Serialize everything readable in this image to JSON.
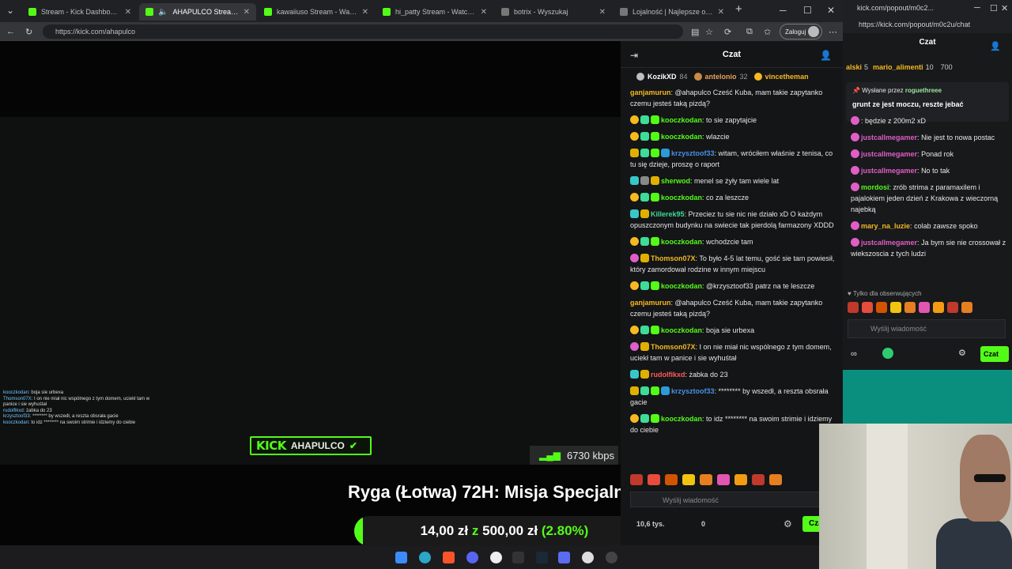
{
  "browser": {
    "tabs": [
      {
        "label": "Stream - Kick Dashboard",
        "active": false
      },
      {
        "label": "AHAPULCO Stream - Watch Live on Kick",
        "active": true
      },
      {
        "label": "kawaiiuso Stream - Watch Live on Kick",
        "active": false
      },
      {
        "label": "hi_patty Stream - Watch Live on Kick",
        "active": false
      },
      {
        "label": "botrix - Wyszukaj",
        "active": false
      },
      {
        "label": "Lojalność | Najlepsze oprogramowanie",
        "active": false
      }
    ],
    "url": "https://kick.com/ahapulco",
    "login_label": "Zaloguj"
  },
  "video": {
    "overlay_chat": [
      {
        "user": "kooczkodan",
        "text": "boja sie urbexa"
      },
      {
        "user": "Thomson07X",
        "text": "I on nie miał nic wspólnego z tym domem, uciekł tam w panice i sie wyhuśtał"
      },
      {
        "user": "rudolfikxd",
        "text": "żabka do 23"
      },
      {
        "user": "krzysztoof33",
        "text": "******** by wszedł, a reszta obsrała gacie"
      },
      {
        "user": "kooczkodan",
        "text": "to idz ******** na swoim strimie i idziemy do ciebie"
      }
    ],
    "kick_word": "KICK",
    "channel_name": "AHAPULCO",
    "bitrate": "6730 kbps",
    "stream_title": "Ryga (Łotwa) 72H: Misja Specjalna",
    "goal": {
      "current": "14,00 zł",
      "sep": "z",
      "target": "500,00 zł",
      "percent_text": "(2.80%)",
      "percent": 0.028
    }
  },
  "chat": {
    "title": "Czat",
    "top_gifters": [
      {
        "name": "KozikXD",
        "count": "84",
        "tier": "silver"
      },
      {
        "name": "antelonio",
        "count": "32",
        "tier": "bronze"
      },
      {
        "name": "vincetheman",
        "count": "",
        "tier": "gold"
      }
    ],
    "messages": [
      {
        "user": "ganjamurun",
        "color": "#f5b921",
        "badges": [],
        "text": "@ahapulco Cześć Kuba, mam takie zapytanko czemu jesteś taką pizdą?"
      },
      {
        "user": "kooczkodan",
        "color": "#53fc18",
        "badges": [
          "coin",
          "grid",
          "green"
        ],
        "text": "to sie zapytajcie"
      },
      {
        "user": "kooczkodan",
        "color": "#53fc18",
        "badges": [
          "coin",
          "grid",
          "green"
        ],
        "text": "wlazcie"
      },
      {
        "user": "krzysztoof33",
        "color": "#4a90e2",
        "badges": [
          "crown",
          "grid",
          "green",
          "blue"
        ],
        "text": "witam, wróciłem właśnie z tenisa, co tu się dzieje, proszę o raport"
      },
      {
        "user": "sherwod",
        "color": "#53fc18",
        "badges": [
          "teal",
          "gray",
          "crown"
        ],
        "text": "menel se żyły tam wiele lat"
      },
      {
        "user": "kooczkodan",
        "color": "#53fc18",
        "badges": [
          "coin",
          "grid",
          "green"
        ],
        "text": "co za leszcze"
      },
      {
        "user": "Killerek95",
        "color": "#3ddc97",
        "badges": [
          "teal",
          "crown"
        ],
        "text": "Przeciez tu sie nic nie działo xD O każdym opuszczonym budynku na swiecie tak pierdolą farmazony XDDD"
      },
      {
        "user": "kooczkodan",
        "color": "#53fc18",
        "badges": [
          "coin",
          "grid",
          "green"
        ],
        "text": "wchodzcie tam"
      },
      {
        "user": "Thomson07X",
        "color": "#f5b921",
        "badges": [
          "pink",
          "crown"
        ],
        "text": "To było 4-5 lat temu, gość sie tam powiesił, który zamordował rodzine w innym miejscu"
      },
      {
        "user": "kooczkodan",
        "color": "#53fc18",
        "badges": [
          "coin",
          "grid",
          "green"
        ],
        "text": "@krzysztoof33 patrz na te leszcze"
      },
      {
        "user": "ganjamurun",
        "color": "#f5b921",
        "badges": [],
        "text": "@ahapulco Cześć Kuba, mam takie zapytanko czemu jesteś taką pizdą?"
      },
      {
        "user": "kooczkodan",
        "color": "#53fc18",
        "badges": [
          "coin",
          "grid",
          "green"
        ],
        "text": "boja sie urbexa"
      },
      {
        "user": "Thomson07X",
        "color": "#f5b921",
        "badges": [
          "pink",
          "crown"
        ],
        "text": "I on nie miał nic wspólnego z tym domem, uciekł tam w panice i sie wyhuśtał"
      },
      {
        "user": "rudolfikxd",
        "color": "#ff5a5a",
        "badges": [
          "teal",
          "crown"
        ],
        "text": "żabka do 23"
      },
      {
        "user": "krzysztoof33",
        "color": "#4a90e2",
        "badges": [
          "crown",
          "grid",
          "green",
          "blue"
        ],
        "text": "******** by wszedł, a reszta obsrała gacie"
      },
      {
        "user": "kooczkodan",
        "color": "#53fc18",
        "badges": [
          "coin",
          "grid",
          "green"
        ],
        "text": "to idz ******** na swoim strimie i idziemy do ciebie"
      }
    ],
    "input_placeholder": "Wyślij wiadomość",
    "viewers": "10,6 tys.",
    "points": "0",
    "send_label": "Czat"
  },
  "popout": {
    "url_title": "kick.com/popout/m0c2...",
    "url": "https://kick.com/popout/m0c2u/chat",
    "title": "Czat",
    "gifters": [
      {
        "name": "alski",
        "count": "5"
      },
      {
        "name": "mario_alimenti",
        "count": "10"
      },
      {
        "name": "",
        "count": "700"
      }
    ],
    "pinned_by_label": "Wysłane przez",
    "pinned_by_user": "roguethreee",
    "pinned_message": "grunt ze jest moczu, reszte jebać",
    "messages": [
      {
        "user": "",
        "color": "#e05ec6",
        "text": "będzie z 200m2 xD"
      },
      {
        "user": "justcallmegamer",
        "color": "#e05ec6",
        "text": "Nie jest to nowa postac"
      },
      {
        "user": "justcallmegamer",
        "color": "#e05ec6",
        "text": "Ponad rok"
      },
      {
        "user": "justcallmegamer",
        "color": "#e05ec6",
        "text": "No to tak"
      },
      {
        "user": "mordosi",
        "color": "#53fc18",
        "text": "zrób strima z paramaxilem i pajalokiem jeden dzień z Krakowa z wieczorną najebką"
      },
      {
        "user": "mary_na_luzie",
        "color": "#f5b921",
        "text": "colab zawsze spoko"
      },
      {
        "user": "justcallmegamer",
        "color": "#e05ec6",
        "text": "Ja bym sie nie crossował z wiekszoscia z tych ludzi"
      }
    ],
    "followers_only": "Tylko dla obserwujących",
    "input_placeholder": "Wyślij wiadomość",
    "send_label": "Czat"
  }
}
